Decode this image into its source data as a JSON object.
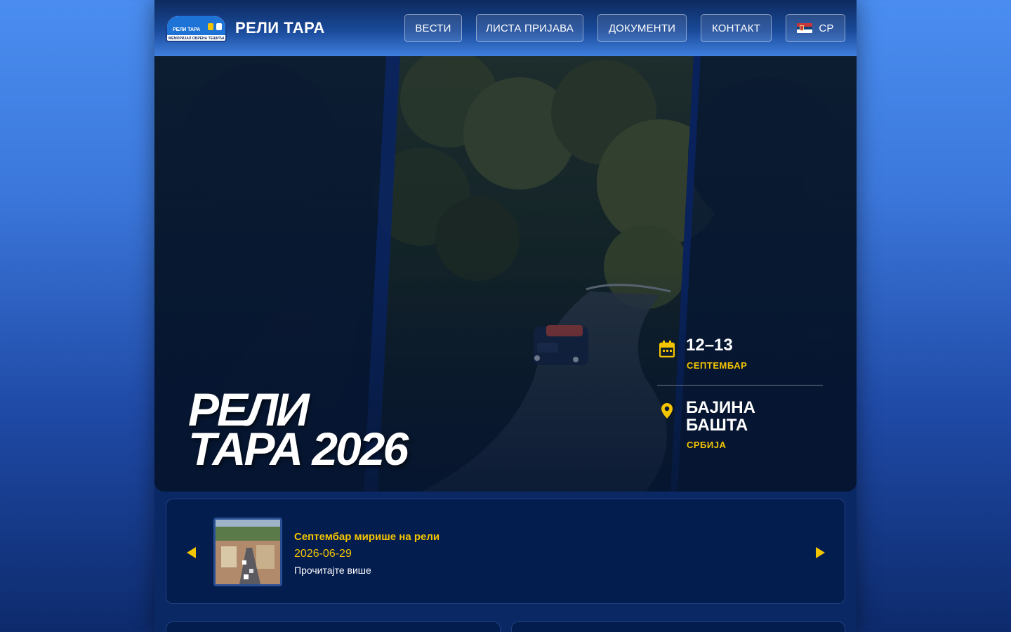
{
  "header": {
    "site_title": "РЕЛИ ТАРА",
    "logo": {
      "line1": "РЕЛИ ТАРА",
      "line2": "",
      "subtitle": "МЕМОРИЈАЛ ОБРЕНА ТЕШИЋА"
    },
    "nav": [
      {
        "label": "ВЕСТИ"
      },
      {
        "label": "ЛИСТА ПРИЈАВА"
      },
      {
        "label": "ДОКУМЕНТИ"
      },
      {
        "label": "КОНТАКТ"
      }
    ],
    "language": {
      "label": "СР",
      "flag": "serbia-flag-icon"
    }
  },
  "hero": {
    "title_line1": "РЕЛИ",
    "title_line2": "ТАРА 2026",
    "date": {
      "icon": "calendar-icon",
      "main": "12–13",
      "sub": "СЕПТЕМБАР"
    },
    "location": {
      "icon": "location-pin-icon",
      "main": "БАЈИНА БАШТА",
      "sub": "СРБИЈА"
    }
  },
  "news": {
    "title": "Септембар мирише на рели",
    "date": "2026-06-29",
    "read_more": "Прочитајте више",
    "prev_icon": "arrow-left-icon",
    "next_icon": "arrow-right-icon"
  },
  "colors": {
    "accent": "#f3c400",
    "page_bg": "#0a2864",
    "card_bg": "#041d4f"
  }
}
